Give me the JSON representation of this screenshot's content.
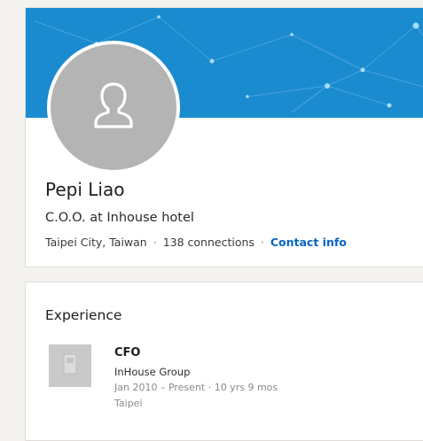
{
  "profile": {
    "name": "Pepi Liao",
    "headline": "C.O.O. at Inhouse hotel",
    "location": "Taipei City, Taiwan",
    "separator": "·",
    "connections": "138 connections",
    "contact_link": "Contact info",
    "avatar_icon": "person-silhouette-icon",
    "banner_color": "#1b8bd0"
  },
  "experience": {
    "heading": "Experience",
    "items": [
      {
        "title": "CFO",
        "company": "InHouse Group",
        "dates": "Jan 2010 – Present · 10 yrs 9 mos",
        "location": "Taipei",
        "logo_icon": "company-building-icon"
      }
    ]
  },
  "colors": {
    "link": "#0a66c2",
    "background": "#f3f2ef"
  }
}
